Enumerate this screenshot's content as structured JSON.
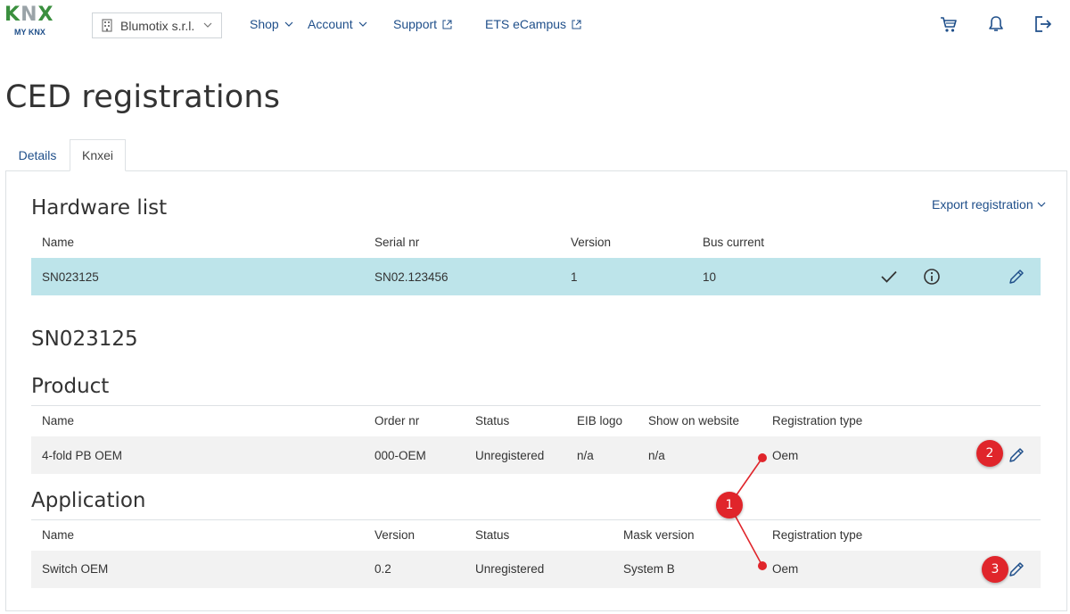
{
  "header": {
    "logo_text_k": "K",
    "logo_text_n": "N",
    "logo_text_x": "X",
    "logo_sub": "MY KNX",
    "company": "Blumotix s.r.l.",
    "nav": [
      {
        "label": "Shop"
      },
      {
        "label": "Account"
      },
      {
        "label": "Support"
      },
      {
        "label": "ETS eCampus"
      }
    ]
  },
  "page": {
    "title": "CED registrations",
    "tabs": [
      {
        "label": "Details"
      },
      {
        "label": "Knxei"
      }
    ]
  },
  "hardware": {
    "title": "Hardware list",
    "export_label": "Export registration",
    "columns": [
      "Name",
      "Serial nr",
      "Version",
      "Bus current"
    ],
    "rows": [
      {
        "name": "SN023125",
        "serial": "SN02.123456",
        "version": "1",
        "bus_current": "10"
      }
    ]
  },
  "selected": {
    "title": "SN023125"
  },
  "product": {
    "title": "Product",
    "columns": [
      "Name",
      "Order nr",
      "Status",
      "EIB logo",
      "Show on website",
      "Registration type"
    ],
    "rows": [
      {
        "name": "4-fold PB OEM",
        "order_nr": "000-OEM",
        "status": "Unregistered",
        "eib_logo": "n/a",
        "show_on_website": "n/a",
        "registration_type": "Oem"
      }
    ]
  },
  "application": {
    "title": "Application",
    "columns": [
      "Name",
      "Version",
      "Status",
      "Mask version",
      "Registration type"
    ],
    "rows": [
      {
        "name": "Switch OEM",
        "version": "0.2",
        "status": "Unregistered",
        "mask_version": "System B",
        "registration_type": "Oem"
      }
    ]
  },
  "annotations": {
    "marker_1": "1",
    "marker_2": "2",
    "marker_3": "3",
    "color": "#e0252b"
  },
  "colors": {
    "accent": "#1f4f8a",
    "row_highlight": "#bde4ea",
    "row_grey": "#f2f2f2"
  }
}
